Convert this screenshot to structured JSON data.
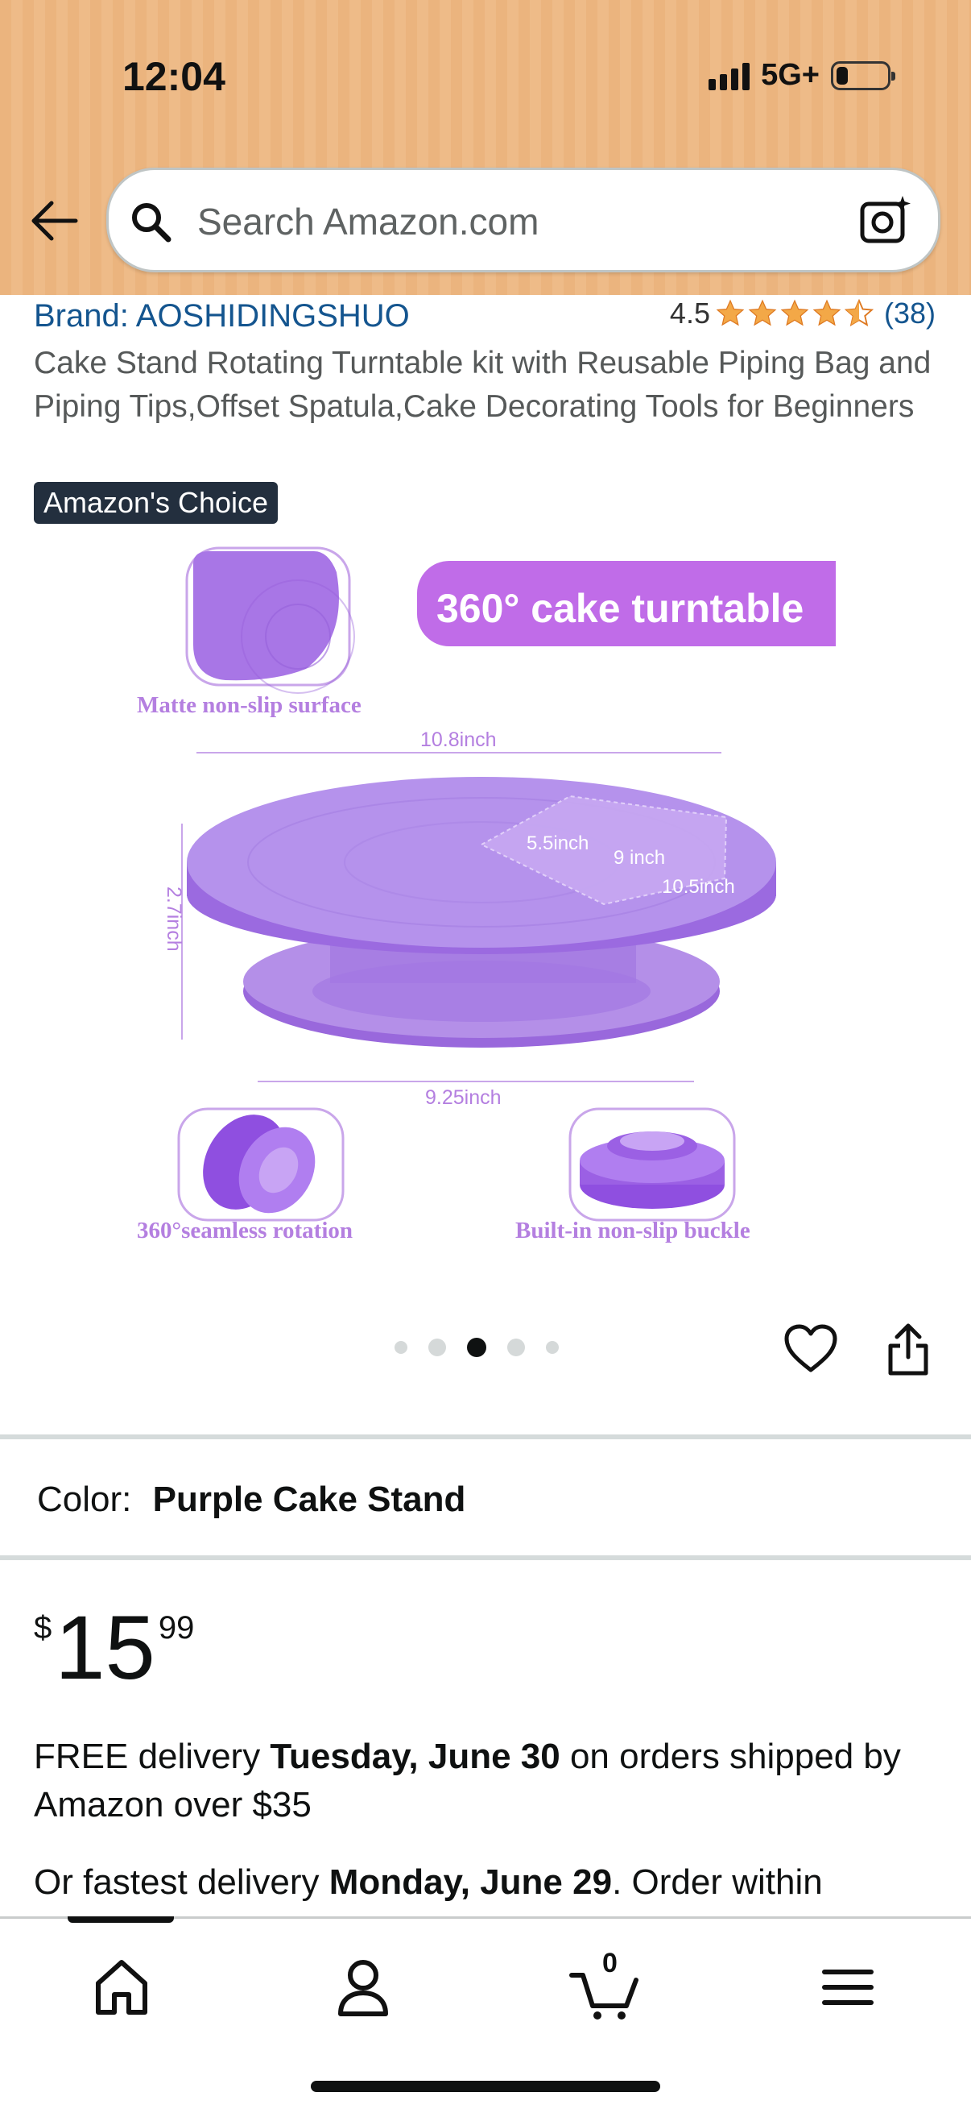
{
  "status_bar": {
    "time": "12:04",
    "network": "5G+"
  },
  "search": {
    "placeholder": "Search Amazon.com"
  },
  "product": {
    "brand": "Brand: AOSHIDINGSHUO",
    "rating_value": "4.5",
    "rating_count": "(38)",
    "title": "Cake Stand Rotating Turntable kit with Reusable Piping Bag and Piping Tips,Offset Spatula,Cake Decorating Tools for Beginners",
    "badge": "Amazon's Choice"
  },
  "image_text": {
    "banner": "360° cake turntable",
    "caption_top": "Matte non-slip surface",
    "width_top": "10.8inch",
    "height": "2.7inch",
    "inner_1": "5.5inch",
    "inner_2": "9 inch",
    "inner_3": "10.5inch",
    "width_bottom": "9.25inch",
    "caption_left": "360°seamless rotation",
    "caption_right": "Built-in non-slip buckle"
  },
  "carousel": {
    "count": 5,
    "active_index": 2
  },
  "color": {
    "label": "Color:",
    "value": "Purple Cake Stand"
  },
  "price": {
    "symbol": "$",
    "whole": "15",
    "fraction": "99"
  },
  "delivery": {
    "prefix": "FREE delivery ",
    "date": "Tuesday, June 30",
    "suffix": " on orders shipped by Amazon over $35"
  },
  "fastest": {
    "prefix": "Or fastest delivery ",
    "date": "Monday, June 29",
    "suffix": ". Order within"
  },
  "bottom_nav": {
    "cart_count": "0"
  },
  "colors": {
    "header_bg": "#ebb47e",
    "link": "#14558f",
    "star": "#f3a847",
    "badge_bg": "#232f3e",
    "purple": "#b48fe8"
  }
}
